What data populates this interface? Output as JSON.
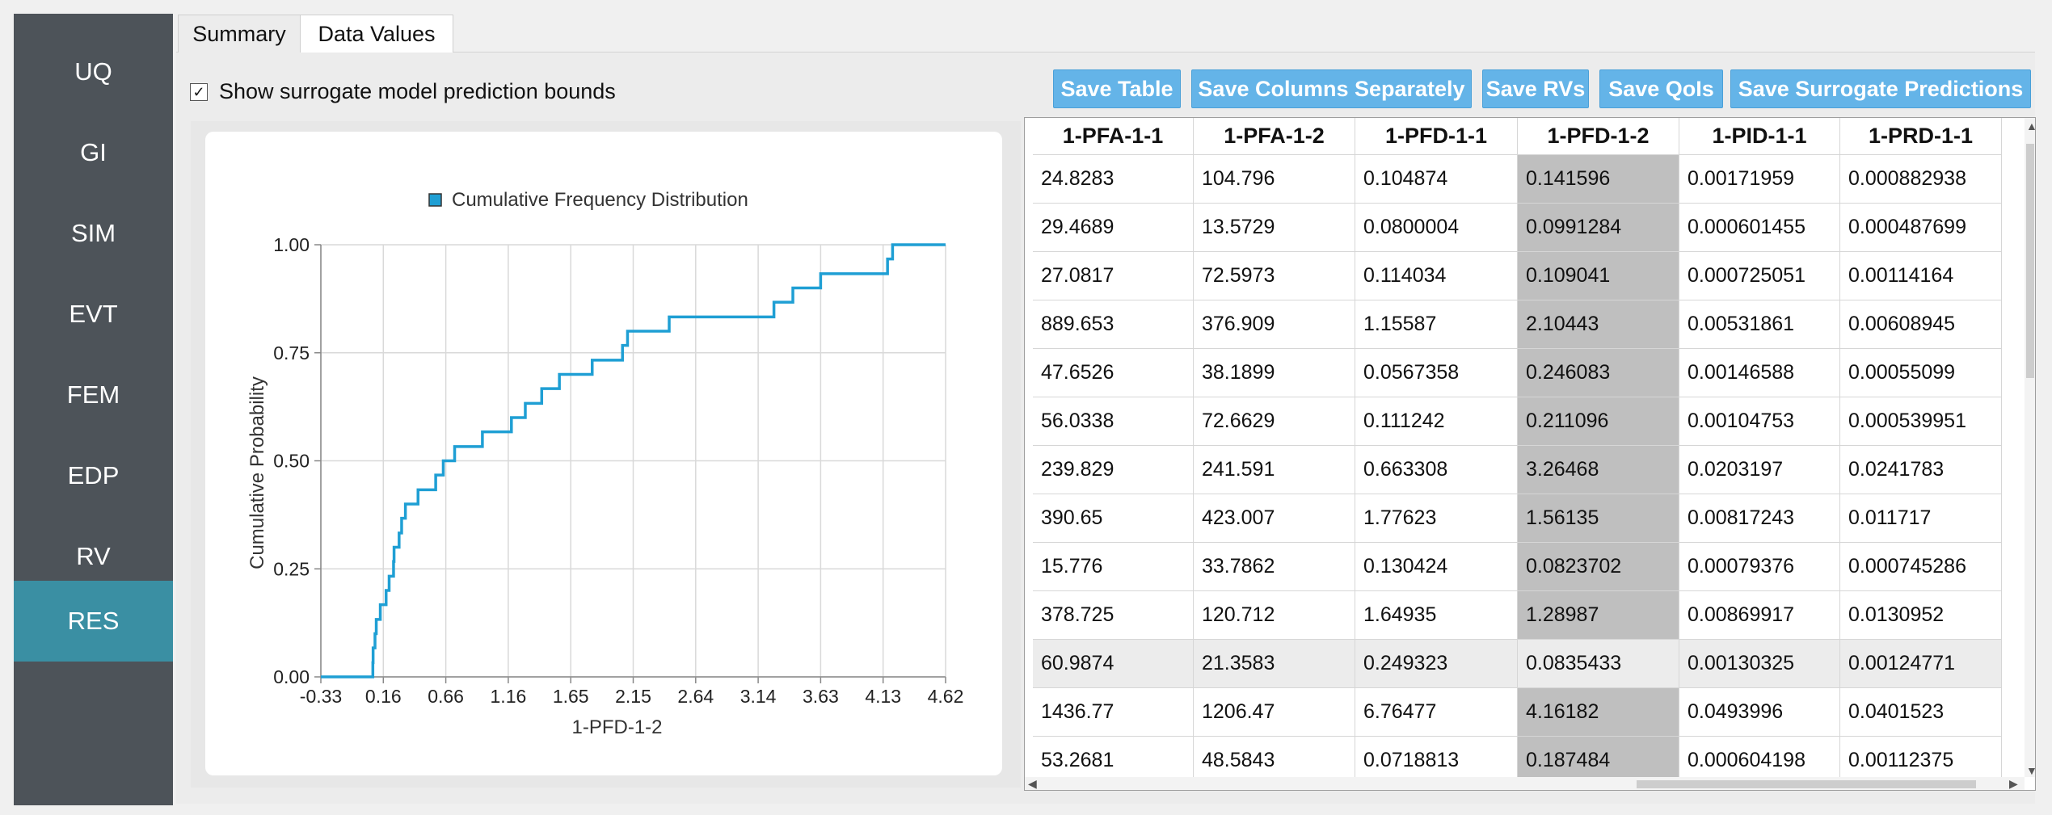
{
  "sidebar": {
    "items": [
      {
        "label": "UQ"
      },
      {
        "label": "GI"
      },
      {
        "label": "SIM"
      },
      {
        "label": "EVT"
      },
      {
        "label": "FEM"
      },
      {
        "label": "EDP"
      },
      {
        "label": "RV"
      },
      {
        "label": "RES"
      }
    ],
    "active": "RES",
    "active_color": "#3a8fa3"
  },
  "tabs": [
    {
      "label": "Summary"
    },
    {
      "label": "Data Values"
    }
  ],
  "active_tab": "Data Values",
  "surrogate_checkbox": {
    "label": "Show surrogate model prediction bounds",
    "checked": true,
    "mark": "☑"
  },
  "buttons": {
    "save_table": "Save Table",
    "save_columns": "Save Columns Separately",
    "save_rvs": "Save RVs",
    "save_qois": "Save QoIs",
    "save_surrogate": "Save Surrogate Predictions",
    "color": "#64b4e8"
  },
  "chart_data": {
    "type": "line",
    "title": "",
    "legend": "Cumulative Frequency Distribution",
    "xlabel": "1-PFD-1-2",
    "ylabel": "Cumulative Probability",
    "xlim": [
      -0.33,
      4.62
    ],
    "ylim": [
      0,
      1
    ],
    "x_ticks": [
      "-0.33",
      "0.16",
      "0.66",
      "1.16",
      "1.65",
      "2.15",
      "2.64",
      "3.14",
      "3.63",
      "4.13",
      "4.62"
    ],
    "y_ticks": [
      "0.00",
      "0.25",
      "0.50",
      "0.75",
      "1.00"
    ],
    "grid": true,
    "line_color": "#1f9fd4",
    "step_x": [
      0.082,
      0.084,
      0.099,
      0.109,
      0.141,
      0.187,
      0.211,
      0.246,
      0.25,
      0.29,
      0.31,
      0.34,
      0.44,
      0.58,
      0.64,
      0.73,
      0.95,
      1.18,
      1.29,
      1.42,
      1.56,
      1.82,
      2.06,
      2.1,
      2.43,
      3.26,
      3.41,
      3.63,
      4.16,
      4.2
    ],
    "step_y": [
      0.033,
      0.067,
      0.1,
      0.133,
      0.167,
      0.2,
      0.233,
      0.267,
      0.3,
      0.333,
      0.367,
      0.4,
      0.433,
      0.467,
      0.5,
      0.533,
      0.567,
      0.6,
      0.633,
      0.667,
      0.7,
      0.733,
      0.767,
      0.8,
      0.833,
      0.867,
      0.9,
      0.933,
      0.967,
      1.0
    ]
  },
  "table": {
    "columns": [
      "1-PFA-1-1",
      "1-PFA-1-2",
      "1-PFD-1-1",
      "1-PFD-1-2",
      "1-PID-1-1",
      "1-PRD-1-1"
    ],
    "selected_column": 3,
    "highlighted_row": 10,
    "rows": [
      [
        "24.8283",
        "104.796",
        "0.104874",
        "0.141596",
        "0.00171959",
        "0.000882938"
      ],
      [
        "29.4689",
        "13.5729",
        "0.0800004",
        "0.0991284",
        "0.000601455",
        "0.000487699"
      ],
      [
        "27.0817",
        "72.5973",
        "0.114034",
        "0.109041",
        "0.000725051",
        "0.00114164"
      ],
      [
        "889.653",
        "376.909",
        "1.15587",
        "2.10443",
        "0.00531861",
        "0.00608945"
      ],
      [
        "47.6526",
        "38.1899",
        "0.0567358",
        "0.246083",
        "0.00146588",
        "0.00055099"
      ],
      [
        "56.0338",
        "72.6629",
        "0.111242",
        "0.211096",
        "0.00104753",
        "0.000539951"
      ],
      [
        "239.829",
        "241.591",
        "0.663308",
        "3.26468",
        "0.0203197",
        "0.0241783"
      ],
      [
        "390.65",
        "423.007",
        "1.77623",
        "1.56135",
        "0.00817243",
        "0.011717"
      ],
      [
        "15.776",
        "33.7862",
        "0.130424",
        "0.0823702",
        "0.00079376",
        "0.000745286"
      ],
      [
        "378.725",
        "120.712",
        "1.64935",
        "1.28987",
        "0.00869917",
        "0.0130952"
      ],
      [
        "60.9874",
        "21.3583",
        "0.249323",
        "0.0835433",
        "0.00130325",
        "0.00124771"
      ],
      [
        "1436.77",
        "1206.47",
        "6.76477",
        "4.16182",
        "0.0493996",
        "0.0401523"
      ],
      [
        "53.2681",
        "48.5843",
        "0.0718813",
        "0.187484",
        "0.000604198",
        "0.00112375"
      ]
    ]
  }
}
